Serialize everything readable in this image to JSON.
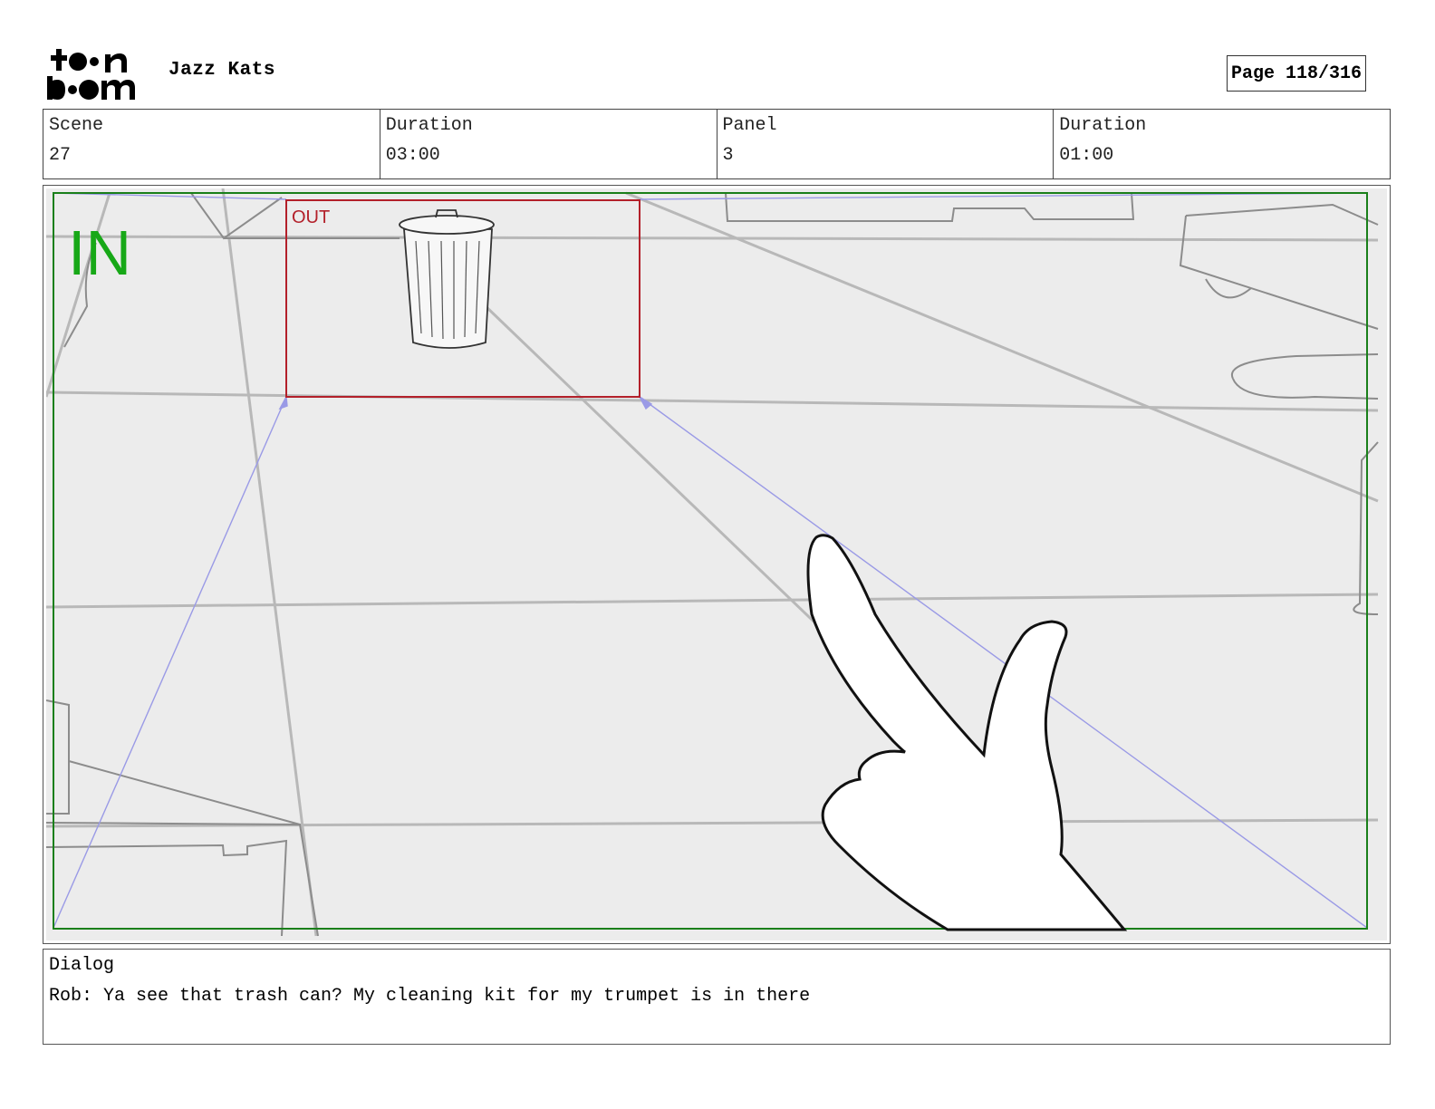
{
  "header": {
    "logo_text_top": "toon",
    "logo_text_bottom": "boom",
    "project_title": "Jazz Kats",
    "page_label": "Page 118/316"
  },
  "info": {
    "scene_label": "Scene",
    "scene_value": "27",
    "scene_duration_label": "Duration",
    "scene_duration_value": "03:00",
    "panel_label": "Panel",
    "panel_value": "3",
    "panel_duration_label": "Duration",
    "panel_duration_value": "01:00"
  },
  "panel": {
    "in_label": "IN",
    "out_label": "OUT",
    "colors": {
      "in_frame": "#1a7f1a",
      "out_frame": "#b3202a",
      "camera_path": "#8f8fe0",
      "background": "#ececec"
    }
  },
  "dialog": {
    "label": "Dialog",
    "text": "Rob: Ya see that trash can? My cleaning kit for my trumpet is in there"
  }
}
